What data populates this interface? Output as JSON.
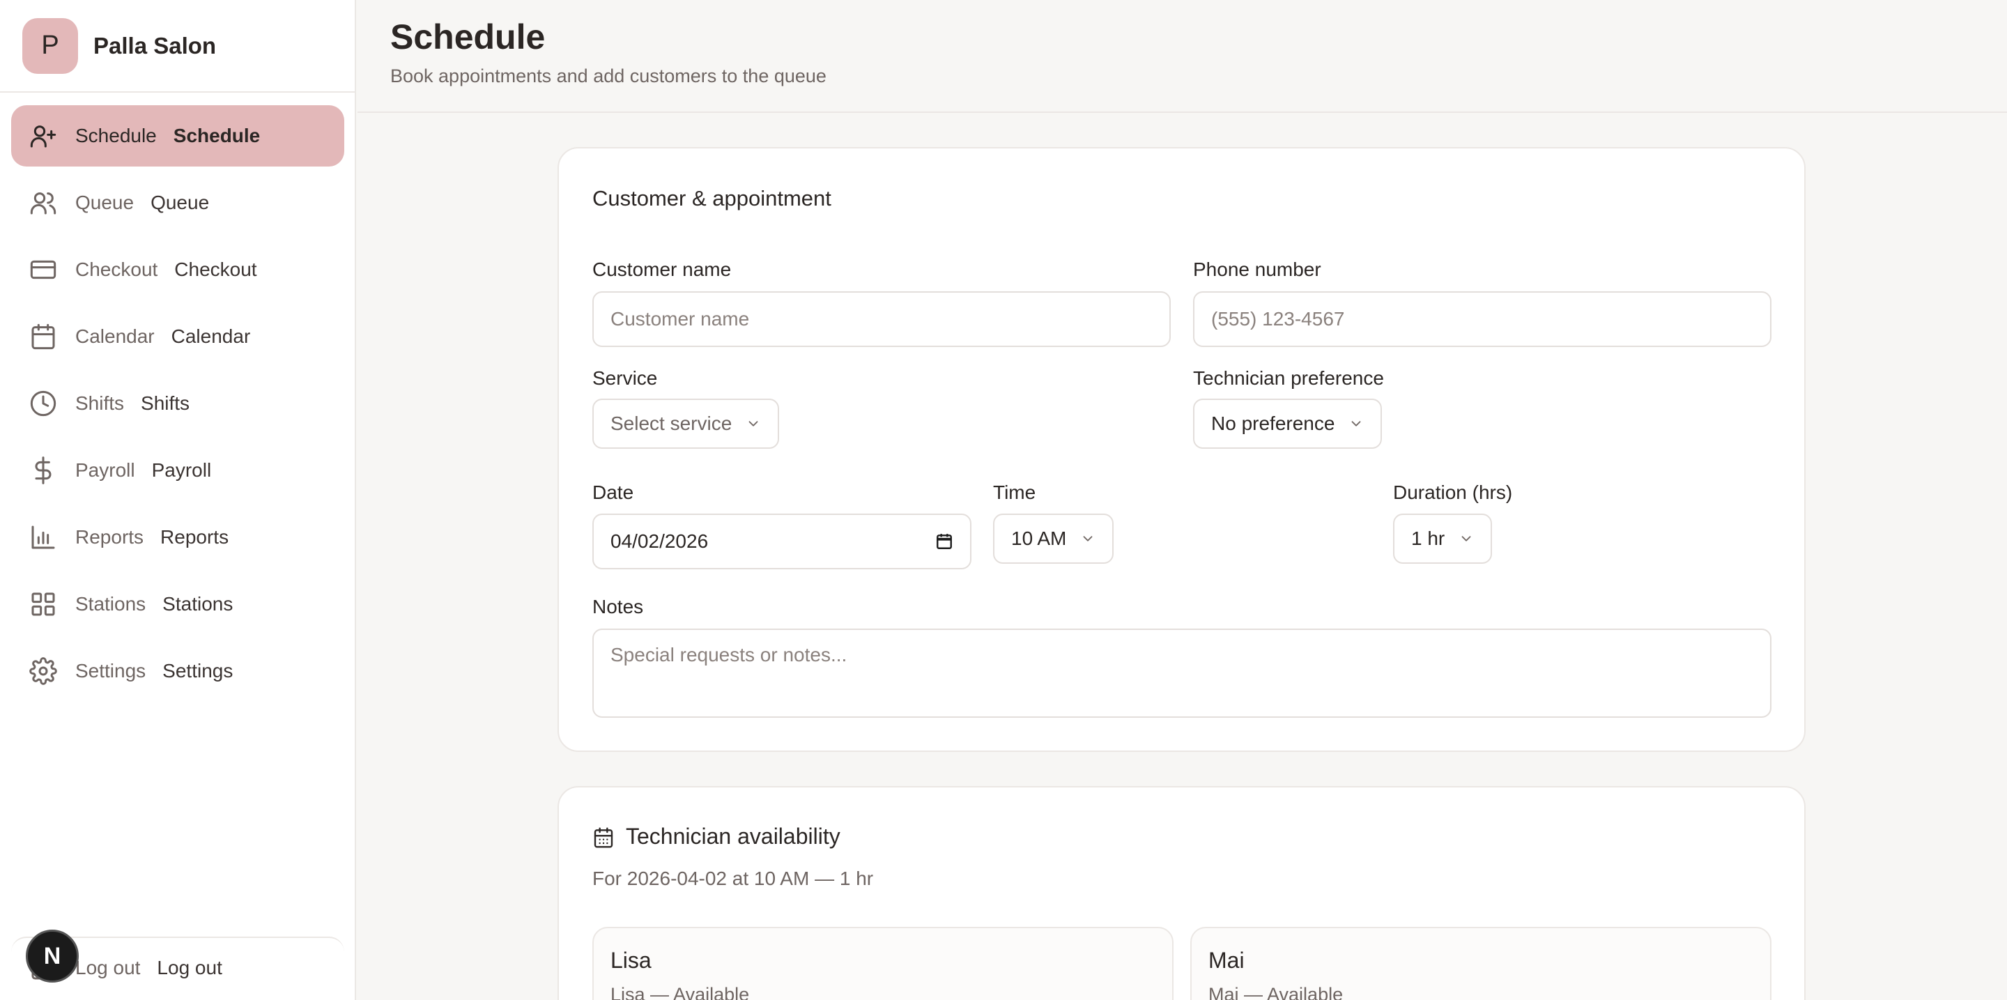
{
  "brand": {
    "logo_letter": "P",
    "name": "Palla Salon"
  },
  "nav": [
    {
      "id": "schedule",
      "label": "Schedule",
      "label2": "Schedule",
      "icon": "user-plus-icon",
      "active": true
    },
    {
      "id": "queue",
      "label": "Queue",
      "label2": "Queue",
      "icon": "users-icon"
    },
    {
      "id": "checkout",
      "label": "Checkout",
      "label2": "Checkout",
      "icon": "credit-card-icon"
    },
    {
      "id": "calendar",
      "label": "Calendar",
      "label2": "Calendar",
      "icon": "calendar-icon"
    },
    {
      "id": "shifts",
      "label": "Shifts",
      "label2": "Shifts",
      "icon": "clock-icon"
    },
    {
      "id": "payroll",
      "label": "Payroll",
      "label2": "Payroll",
      "icon": "dollar-icon"
    },
    {
      "id": "reports",
      "label": "Reports",
      "label2": "Reports",
      "icon": "bar-chart-icon"
    },
    {
      "id": "stations",
      "label": "Stations",
      "label2": "Stations",
      "icon": "grid-icon"
    },
    {
      "id": "settings",
      "label": "Settings",
      "label2": "Settings",
      "icon": "gear-icon"
    }
  ],
  "logout": {
    "label": "Log out",
    "label2": "Log out"
  },
  "dev_badge": {
    "letter": "N"
  },
  "header": {
    "title": "Schedule",
    "subtitle": "Book appointments and add customers to the queue"
  },
  "form": {
    "title": "Customer & appointment",
    "customer_name": {
      "label": "Customer name",
      "placeholder": "Customer name"
    },
    "phone": {
      "label": "Phone number",
      "placeholder": "(555) 123-4567"
    },
    "service": {
      "label": "Service",
      "value": "Select service"
    },
    "technician": {
      "label": "Technician preference",
      "value": "No preference"
    },
    "date": {
      "label": "Date",
      "value": "04/02/2026"
    },
    "time": {
      "label": "Time",
      "value": "10 AM"
    },
    "duration": {
      "label": "Duration (hrs)",
      "value": "1 hr"
    },
    "notes": {
      "label": "Notes",
      "placeholder": "Special requests or notes..."
    }
  },
  "availability": {
    "title": "Technician availability",
    "subtitle": "For 2026-04-02 at 10 AM — 1 hr",
    "technicians": [
      {
        "name": "Lisa",
        "status": "Lisa — Available"
      },
      {
        "name": "Mai",
        "status": "Mai — Available"
      }
    ]
  },
  "colors": {
    "accent": "#e3b8b9",
    "background": "#f7f6f4",
    "text": "#2b2624",
    "muted": "#6e6562"
  }
}
